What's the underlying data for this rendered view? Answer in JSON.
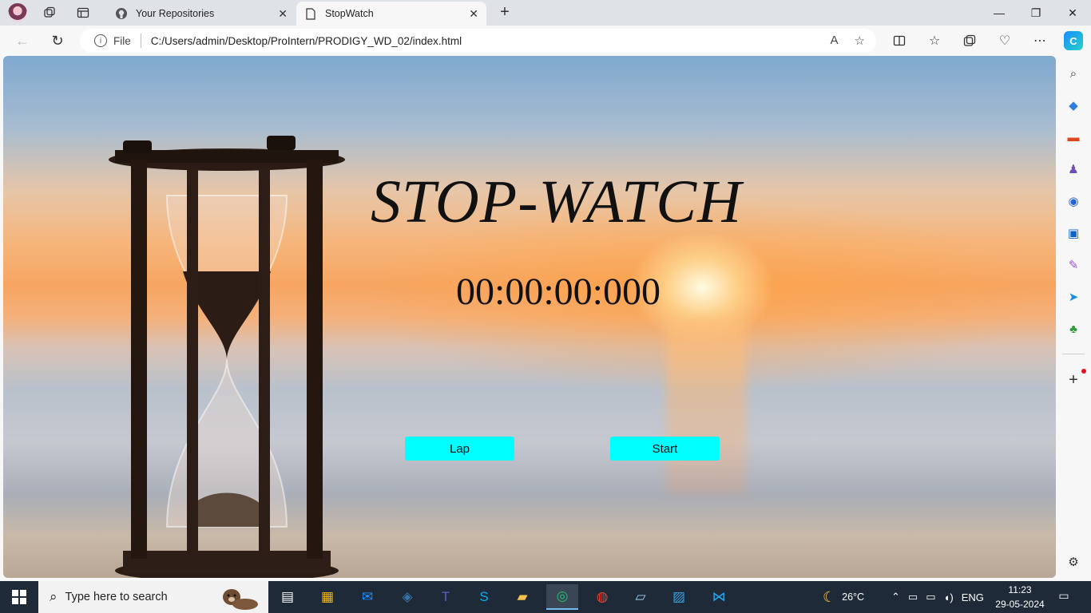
{
  "browser": {
    "tabs": [
      {
        "label": "Your Repositories",
        "icon": "github-icon"
      },
      {
        "label": "StopWatch",
        "icon": "page-icon"
      }
    ],
    "address": {
      "scheme_label": "File",
      "url": "C:/Users/admin/Desktop/ProIntern/PRODIGY_WD_02/index.html"
    }
  },
  "page": {
    "title": "STOP-WATCH",
    "time": "00:00:00:000",
    "lap_label": "Lap",
    "start_label": "Start",
    "button_color": "#00ffff"
  },
  "taskbar": {
    "search_placeholder": "Type here to search",
    "weather": "26°C",
    "language": "ENG",
    "time": "11:23",
    "date": "29-05-2024"
  }
}
